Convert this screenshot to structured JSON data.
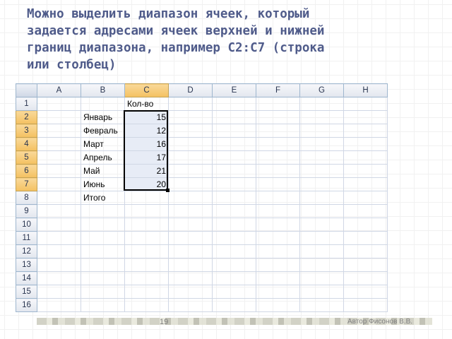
{
  "title": "Можно выделить диапазон ячеек, который\nзадается адресами ячеек верхней и нижней\nграниц диапазона, например C2:C7 (строка\nили столбец)",
  "sheet": {
    "columns": [
      "A",
      "B",
      "C",
      "D",
      "E",
      "F",
      "G",
      "H"
    ],
    "rows": [
      "1",
      "2",
      "3",
      "4",
      "5",
      "6",
      "7",
      "8",
      "9",
      "10",
      "11",
      "12",
      "13",
      "14",
      "15",
      "16"
    ],
    "header_c1": "Кол-во",
    "months": [
      "Январь",
      "Февраль",
      "Март",
      "Апрель",
      "Май",
      "Июнь"
    ],
    "values": [
      "15",
      "12",
      "16",
      "17",
      "21",
      "20"
    ],
    "total_label": "Итого"
  },
  "footer": {
    "slide_number": "19",
    "author": "Автор Фисонов В.В."
  },
  "colors": {
    "title": "#4f5b8a",
    "selected_header": "#f4c161",
    "selected_cells": "#e7ecf6"
  }
}
